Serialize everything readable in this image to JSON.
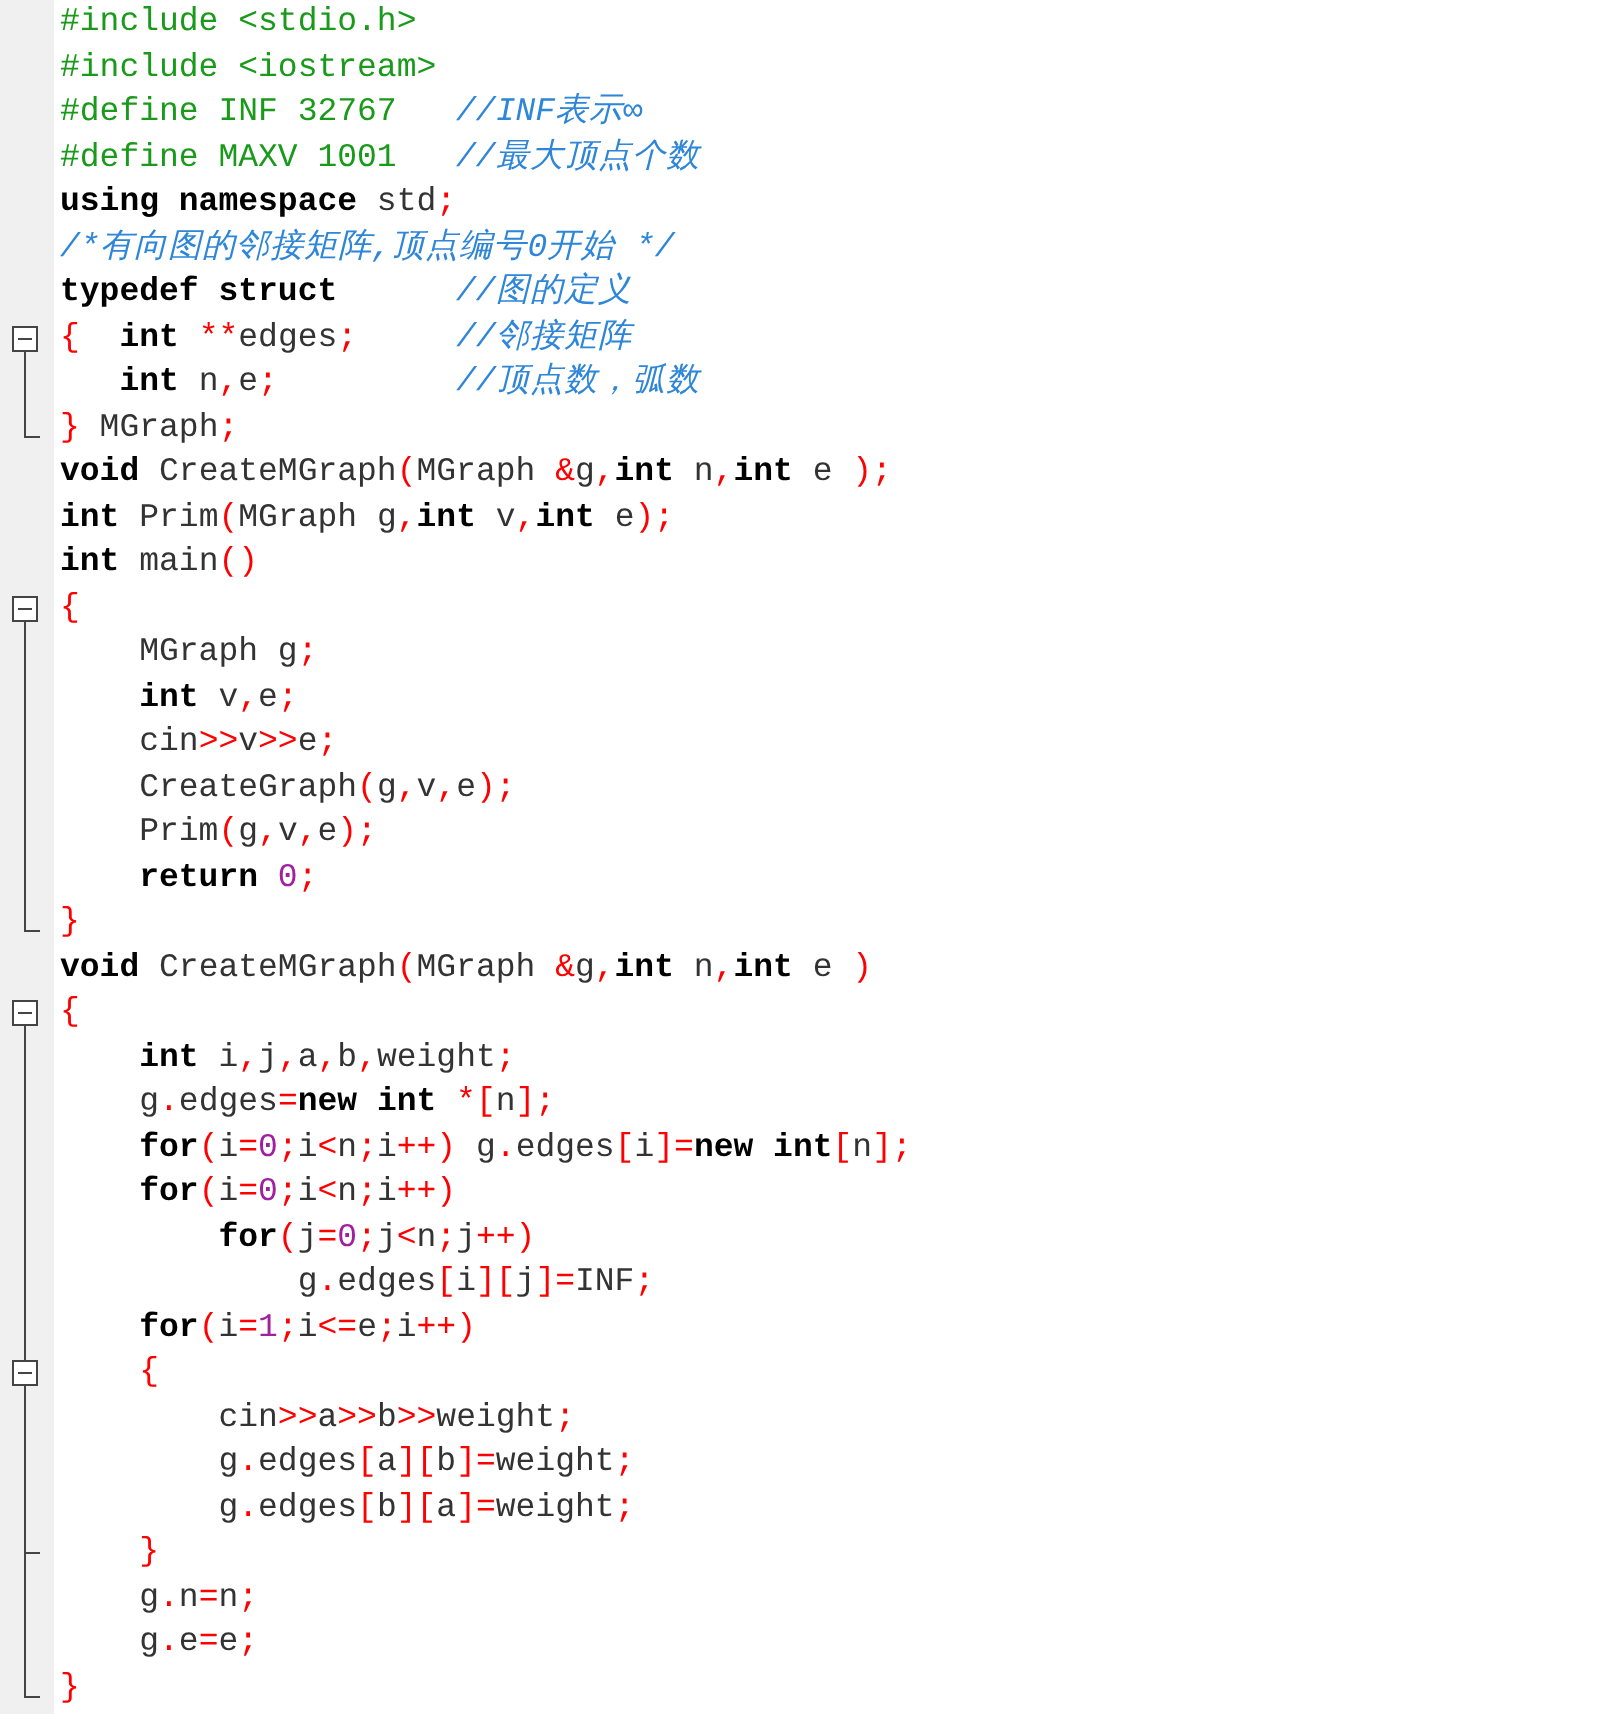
{
  "editor": {
    "lines": [
      {
        "kind": "plain",
        "segments": [
          {
            "kind": "pre",
            "text": "#include <stdio.h>"
          }
        ]
      },
      {
        "kind": "plain",
        "segments": [
          {
            "kind": "pre",
            "text": "#include <iostream>"
          }
        ]
      },
      {
        "kind": "plain",
        "segments": [
          {
            "kind": "pre",
            "text": "#define INF 32767"
          },
          {
            "kind": "cmt",
            "text": "   //INF表示∞"
          }
        ]
      },
      {
        "kind": "plain",
        "segments": [
          {
            "kind": "pre",
            "text": "#define MAXV 1001"
          },
          {
            "kind": "cmt",
            "text": "   //最大顶点个数"
          }
        ]
      },
      {
        "kind": "plain",
        "segments": [
          {
            "kind": "kw",
            "text": "using namespace"
          },
          {
            "kind": "txt",
            "text": " std"
          },
          {
            "kind": "op",
            "text": ";"
          }
        ]
      },
      {
        "kind": "plain",
        "segments": [
          {
            "kind": "cmt",
            "text": "/*有向图的邻接矩阵,顶点编号0开始 */"
          }
        ]
      },
      {
        "kind": "plain",
        "segments": [
          {
            "kind": "kw",
            "text": "typedef struct"
          },
          {
            "kind": "cmt",
            "text": "      //图的定义"
          }
        ]
      },
      {
        "kind": "open",
        "segments": [
          {
            "kind": "op",
            "text": "{"
          },
          {
            "kind": "kw",
            "text": "  int"
          },
          {
            "kind": "op",
            "text": " **"
          },
          {
            "kind": "txt",
            "text": "edges"
          },
          {
            "kind": "op",
            "text": ";"
          },
          {
            "kind": "cmt",
            "text": "     //邻接矩阵"
          }
        ]
      },
      {
        "kind": "inside",
        "segments": [
          {
            "kind": "kw",
            "text": "   int"
          },
          {
            "kind": "txt",
            "text": " n"
          },
          {
            "kind": "op",
            "text": ","
          },
          {
            "kind": "txt",
            "text": "e"
          },
          {
            "kind": "op",
            "text": ";"
          },
          {
            "kind": "cmt",
            "text": "         //顶点数，弧数"
          }
        ]
      },
      {
        "kind": "close",
        "segments": [
          {
            "kind": "op",
            "text": "}"
          },
          {
            "kind": "txt",
            "text": " MGraph"
          },
          {
            "kind": "op",
            "text": ";"
          }
        ]
      },
      {
        "kind": "plain",
        "segments": [
          {
            "kind": "kw",
            "text": "void"
          },
          {
            "kind": "txt",
            "text": " CreateMGraph"
          },
          {
            "kind": "op",
            "text": "("
          },
          {
            "kind": "txt",
            "text": "MGraph "
          },
          {
            "kind": "op",
            "text": "&"
          },
          {
            "kind": "txt",
            "text": "g"
          },
          {
            "kind": "op",
            "text": ","
          },
          {
            "kind": "kw",
            "text": "int"
          },
          {
            "kind": "txt",
            "text": " n"
          },
          {
            "kind": "op",
            "text": ","
          },
          {
            "kind": "kw",
            "text": "int"
          },
          {
            "kind": "txt",
            "text": " e "
          },
          {
            "kind": "op",
            "text": ");"
          }
        ]
      },
      {
        "kind": "plain",
        "segments": [
          {
            "kind": "kw",
            "text": "int"
          },
          {
            "kind": "txt",
            "text": " Prim"
          },
          {
            "kind": "op",
            "text": "("
          },
          {
            "kind": "txt",
            "text": "MGraph g"
          },
          {
            "kind": "op",
            "text": ","
          },
          {
            "kind": "kw",
            "text": "int"
          },
          {
            "kind": "txt",
            "text": " v"
          },
          {
            "kind": "op",
            "text": ","
          },
          {
            "kind": "kw",
            "text": "int"
          },
          {
            "kind": "txt",
            "text": " e"
          },
          {
            "kind": "op",
            "text": ");"
          }
        ]
      },
      {
        "kind": "plain",
        "segments": [
          {
            "kind": "kw",
            "text": "int"
          },
          {
            "kind": "txt",
            "text": " main"
          },
          {
            "kind": "op",
            "text": "()"
          }
        ]
      },
      {
        "kind": "open",
        "segments": [
          {
            "kind": "op",
            "text": "{"
          }
        ]
      },
      {
        "kind": "inside",
        "segments": [
          {
            "kind": "txt",
            "text": "    MGraph g"
          },
          {
            "kind": "op",
            "text": ";"
          }
        ]
      },
      {
        "kind": "inside",
        "segments": [
          {
            "kind": "kw",
            "text": "    int"
          },
          {
            "kind": "txt",
            "text": " v"
          },
          {
            "kind": "op",
            "text": ","
          },
          {
            "kind": "txt",
            "text": "e"
          },
          {
            "kind": "op",
            "text": ";"
          }
        ]
      },
      {
        "kind": "inside",
        "segments": [
          {
            "kind": "txt",
            "text": "    cin"
          },
          {
            "kind": "op",
            "text": ">>"
          },
          {
            "kind": "txt",
            "text": "v"
          },
          {
            "kind": "op",
            "text": ">>"
          },
          {
            "kind": "txt",
            "text": "e"
          },
          {
            "kind": "op",
            "text": ";"
          }
        ]
      },
      {
        "kind": "inside",
        "segments": [
          {
            "kind": "txt",
            "text": "    CreateGraph"
          },
          {
            "kind": "op",
            "text": "("
          },
          {
            "kind": "txt",
            "text": "g"
          },
          {
            "kind": "op",
            "text": ","
          },
          {
            "kind": "txt",
            "text": "v"
          },
          {
            "kind": "op",
            "text": ","
          },
          {
            "kind": "txt",
            "text": "e"
          },
          {
            "kind": "op",
            "text": ");"
          }
        ]
      },
      {
        "kind": "inside",
        "segments": [
          {
            "kind": "txt",
            "text": "    Prim"
          },
          {
            "kind": "op",
            "text": "("
          },
          {
            "kind": "txt",
            "text": "g"
          },
          {
            "kind": "op",
            "text": ","
          },
          {
            "kind": "txt",
            "text": "v"
          },
          {
            "kind": "op",
            "text": ","
          },
          {
            "kind": "txt",
            "text": "e"
          },
          {
            "kind": "op",
            "text": ");"
          }
        ]
      },
      {
        "kind": "inside",
        "segments": [
          {
            "kind": "kw",
            "text": "    return"
          },
          {
            "kind": "num",
            "text": " 0"
          },
          {
            "kind": "op",
            "text": ";"
          }
        ]
      },
      {
        "kind": "close",
        "segments": [
          {
            "kind": "op",
            "text": "}"
          }
        ]
      },
      {
        "kind": "plain",
        "segments": [
          {
            "kind": "kw",
            "text": "void"
          },
          {
            "kind": "txt",
            "text": " CreateMGraph"
          },
          {
            "kind": "op",
            "text": "("
          },
          {
            "kind": "txt",
            "text": "MGraph "
          },
          {
            "kind": "op",
            "text": "&"
          },
          {
            "kind": "txt",
            "text": "g"
          },
          {
            "kind": "op",
            "text": ","
          },
          {
            "kind": "kw",
            "text": "int"
          },
          {
            "kind": "txt",
            "text": " n"
          },
          {
            "kind": "op",
            "text": ","
          },
          {
            "kind": "kw",
            "text": "int"
          },
          {
            "kind": "txt",
            "text": " e "
          },
          {
            "kind": "op",
            "text": ")"
          }
        ]
      },
      {
        "kind": "open",
        "segments": [
          {
            "kind": "op",
            "text": "{"
          }
        ]
      },
      {
        "kind": "inside",
        "segments": [
          {
            "kind": "kw",
            "text": "    int"
          },
          {
            "kind": "txt",
            "text": " i"
          },
          {
            "kind": "op",
            "text": ","
          },
          {
            "kind": "txt",
            "text": "j"
          },
          {
            "kind": "op",
            "text": ","
          },
          {
            "kind": "txt",
            "text": "a"
          },
          {
            "kind": "op",
            "text": ","
          },
          {
            "kind": "txt",
            "text": "b"
          },
          {
            "kind": "op",
            "text": ","
          },
          {
            "kind": "txt",
            "text": "weight"
          },
          {
            "kind": "op",
            "text": ";"
          }
        ]
      },
      {
        "kind": "inside",
        "segments": [
          {
            "kind": "txt",
            "text": "    g"
          },
          {
            "kind": "op",
            "text": "."
          },
          {
            "kind": "txt",
            "text": "edges"
          },
          {
            "kind": "op",
            "text": "="
          },
          {
            "kind": "kw",
            "text": "new int"
          },
          {
            "kind": "op",
            "text": " *["
          },
          {
            "kind": "txt",
            "text": "n"
          },
          {
            "kind": "op",
            "text": "];"
          }
        ]
      },
      {
        "kind": "inside",
        "segments": [
          {
            "kind": "kw",
            "text": "    for"
          },
          {
            "kind": "op",
            "text": "("
          },
          {
            "kind": "txt",
            "text": "i"
          },
          {
            "kind": "op",
            "text": "="
          },
          {
            "kind": "num",
            "text": "0"
          },
          {
            "kind": "op",
            "text": ";"
          },
          {
            "kind": "txt",
            "text": "i"
          },
          {
            "kind": "op",
            "text": "<"
          },
          {
            "kind": "txt",
            "text": "n"
          },
          {
            "kind": "op",
            "text": ";"
          },
          {
            "kind": "txt",
            "text": "i"
          },
          {
            "kind": "op",
            "text": "++)"
          },
          {
            "kind": "txt",
            "text": " g"
          },
          {
            "kind": "op",
            "text": "."
          },
          {
            "kind": "txt",
            "text": "edges"
          },
          {
            "kind": "op",
            "text": "["
          },
          {
            "kind": "txt",
            "text": "i"
          },
          {
            "kind": "op",
            "text": "]="
          },
          {
            "kind": "kw",
            "text": "new int"
          },
          {
            "kind": "op",
            "text": "["
          },
          {
            "kind": "txt",
            "text": "n"
          },
          {
            "kind": "op",
            "text": "];"
          }
        ]
      },
      {
        "kind": "inside",
        "segments": [
          {
            "kind": "kw",
            "text": "    for"
          },
          {
            "kind": "op",
            "text": "("
          },
          {
            "kind": "txt",
            "text": "i"
          },
          {
            "kind": "op",
            "text": "="
          },
          {
            "kind": "num",
            "text": "0"
          },
          {
            "kind": "op",
            "text": ";"
          },
          {
            "kind": "txt",
            "text": "i"
          },
          {
            "kind": "op",
            "text": "<"
          },
          {
            "kind": "txt",
            "text": "n"
          },
          {
            "kind": "op",
            "text": ";"
          },
          {
            "kind": "txt",
            "text": "i"
          },
          {
            "kind": "op",
            "text": "++)"
          }
        ]
      },
      {
        "kind": "inside",
        "segments": [
          {
            "kind": "kw",
            "text": "        for"
          },
          {
            "kind": "op",
            "text": "("
          },
          {
            "kind": "txt",
            "text": "j"
          },
          {
            "kind": "op",
            "text": "="
          },
          {
            "kind": "num",
            "text": "0"
          },
          {
            "kind": "op",
            "text": ";"
          },
          {
            "kind": "txt",
            "text": "j"
          },
          {
            "kind": "op",
            "text": "<"
          },
          {
            "kind": "txt",
            "text": "n"
          },
          {
            "kind": "op",
            "text": ";"
          },
          {
            "kind": "txt",
            "text": "j"
          },
          {
            "kind": "op",
            "text": "++)"
          }
        ]
      },
      {
        "kind": "inside",
        "segments": [
          {
            "kind": "txt",
            "text": "            g"
          },
          {
            "kind": "op",
            "text": "."
          },
          {
            "kind": "txt",
            "text": "edges"
          },
          {
            "kind": "op",
            "text": "["
          },
          {
            "kind": "txt",
            "text": "i"
          },
          {
            "kind": "op",
            "text": "]["
          },
          {
            "kind": "txt",
            "text": "j"
          },
          {
            "kind": "op",
            "text": "]="
          },
          {
            "kind": "txt",
            "text": "INF"
          },
          {
            "kind": "op",
            "text": ";"
          }
        ]
      },
      {
        "kind": "inside",
        "segments": [
          {
            "kind": "kw",
            "text": "    for"
          },
          {
            "kind": "op",
            "text": "("
          },
          {
            "kind": "txt",
            "text": "i"
          },
          {
            "kind": "op",
            "text": "="
          },
          {
            "kind": "num",
            "text": "1"
          },
          {
            "kind": "op",
            "text": ";"
          },
          {
            "kind": "txt",
            "text": "i"
          },
          {
            "kind": "op",
            "text": "<="
          },
          {
            "kind": "txt",
            "text": "e"
          },
          {
            "kind": "op",
            "text": ";"
          },
          {
            "kind": "txt",
            "text": "i"
          },
          {
            "kind": "op",
            "text": "++)"
          }
        ]
      },
      {
        "kind": "nested",
        "segments": [
          {
            "kind": "op",
            "text": "    {"
          }
        ]
      },
      {
        "kind": "inside",
        "segments": [
          {
            "kind": "txt",
            "text": "        cin"
          },
          {
            "kind": "op",
            "text": ">>"
          },
          {
            "kind": "txt",
            "text": "a"
          },
          {
            "kind": "op",
            "text": ">>"
          },
          {
            "kind": "txt",
            "text": "b"
          },
          {
            "kind": "op",
            "text": ">>"
          },
          {
            "kind": "txt",
            "text": "weight"
          },
          {
            "kind": "op",
            "text": ";"
          }
        ]
      },
      {
        "kind": "inside",
        "segments": [
          {
            "kind": "txt",
            "text": "        g"
          },
          {
            "kind": "op",
            "text": "."
          },
          {
            "kind": "txt",
            "text": "edges"
          },
          {
            "kind": "op",
            "text": "["
          },
          {
            "kind": "txt",
            "text": "a"
          },
          {
            "kind": "op",
            "text": "]["
          },
          {
            "kind": "txt",
            "text": "b"
          },
          {
            "kind": "op",
            "text": "]="
          },
          {
            "kind": "txt",
            "text": "weight"
          },
          {
            "kind": "op",
            "text": ";"
          }
        ]
      },
      {
        "kind": "inside",
        "segments": [
          {
            "kind": "txt",
            "text": "        g"
          },
          {
            "kind": "op",
            "text": "."
          },
          {
            "kind": "txt",
            "text": "edges"
          },
          {
            "kind": "op",
            "text": "["
          },
          {
            "kind": "txt",
            "text": "b"
          },
          {
            "kind": "op",
            "text": "]["
          },
          {
            "kind": "txt",
            "text": "a"
          },
          {
            "kind": "op",
            "text": "]="
          },
          {
            "kind": "txt",
            "text": "weight"
          },
          {
            "kind": "op",
            "text": ";"
          }
        ]
      },
      {
        "kind": "tee",
        "segments": [
          {
            "kind": "op",
            "text": "    }"
          }
        ]
      },
      {
        "kind": "inside",
        "segments": [
          {
            "kind": "txt",
            "text": "    g"
          },
          {
            "kind": "op",
            "text": "."
          },
          {
            "kind": "txt",
            "text": "n"
          },
          {
            "kind": "op",
            "text": "="
          },
          {
            "kind": "txt",
            "text": "n"
          },
          {
            "kind": "op",
            "text": ";"
          }
        ]
      },
      {
        "kind": "inside",
        "segments": [
          {
            "kind": "txt",
            "text": "    g"
          },
          {
            "kind": "op",
            "text": "."
          },
          {
            "kind": "txt",
            "text": "e"
          },
          {
            "kind": "op",
            "text": "="
          },
          {
            "kind": "txt",
            "text": "e"
          },
          {
            "kind": "op",
            "text": ";"
          }
        ]
      },
      {
        "kind": "close",
        "segments": [
          {
            "kind": "op",
            "text": "}"
          }
        ]
      }
    ]
  }
}
